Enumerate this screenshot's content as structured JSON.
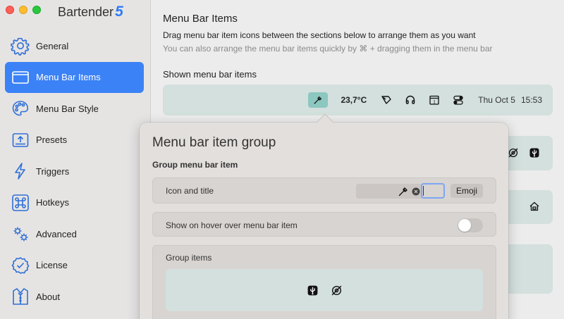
{
  "app": {
    "name": "Bartender",
    "version": "5"
  },
  "sidebar": {
    "items": [
      {
        "label": "General",
        "icon": "gear-icon",
        "active": false
      },
      {
        "label": "Menu Bar Items",
        "icon": "menu-bar-icon",
        "active": true
      },
      {
        "label": "Menu Bar Style",
        "icon": "palette-icon",
        "active": false
      },
      {
        "label": "Presets",
        "icon": "presets-icon",
        "active": false
      },
      {
        "label": "Triggers",
        "icon": "lightning-icon",
        "active": false
      },
      {
        "label": "Hotkeys",
        "icon": "command-key-icon",
        "active": false
      },
      {
        "label": "Advanced",
        "icon": "gears-icon",
        "active": false
      },
      {
        "label": "License",
        "icon": "checkmark-seal-icon",
        "active": false
      },
      {
        "label": "About",
        "icon": "tuxedo-icon",
        "active": false
      }
    ]
  },
  "main": {
    "title": "Menu Bar Items",
    "description": "Drag menu bar item icons between the sections below to arrange them as you want",
    "hint": "You can also arrange the menu bar items quickly by ⌘ + dragging them in the menu bar",
    "shown_label": "Shown menu bar items",
    "menubar": {
      "temperature": "23,7°C",
      "date": "Thu Oct 5",
      "time": "15:53",
      "icons": [
        "eyedropper-icon",
        "weather-icon",
        "headphones-icon",
        "calendar-icon",
        "control-center-icon"
      ]
    }
  },
  "popover": {
    "title": "Menu bar item group",
    "subtitle": "Group menu bar item",
    "icon_title_label": "Icon and title",
    "emoji_button": "Emoji",
    "title_value": "",
    "hover_label": "Show on hover over menu bar item",
    "hover_enabled": false,
    "group_items_label": "Group items",
    "group_items": [
      "usb-icon",
      "eye-slash-icon"
    ]
  },
  "colors": {
    "accent": "#3b82f6",
    "version": "#2f7cf6",
    "section_bg": "#d3e0dd",
    "selected_item": "#8cc7c0"
  }
}
